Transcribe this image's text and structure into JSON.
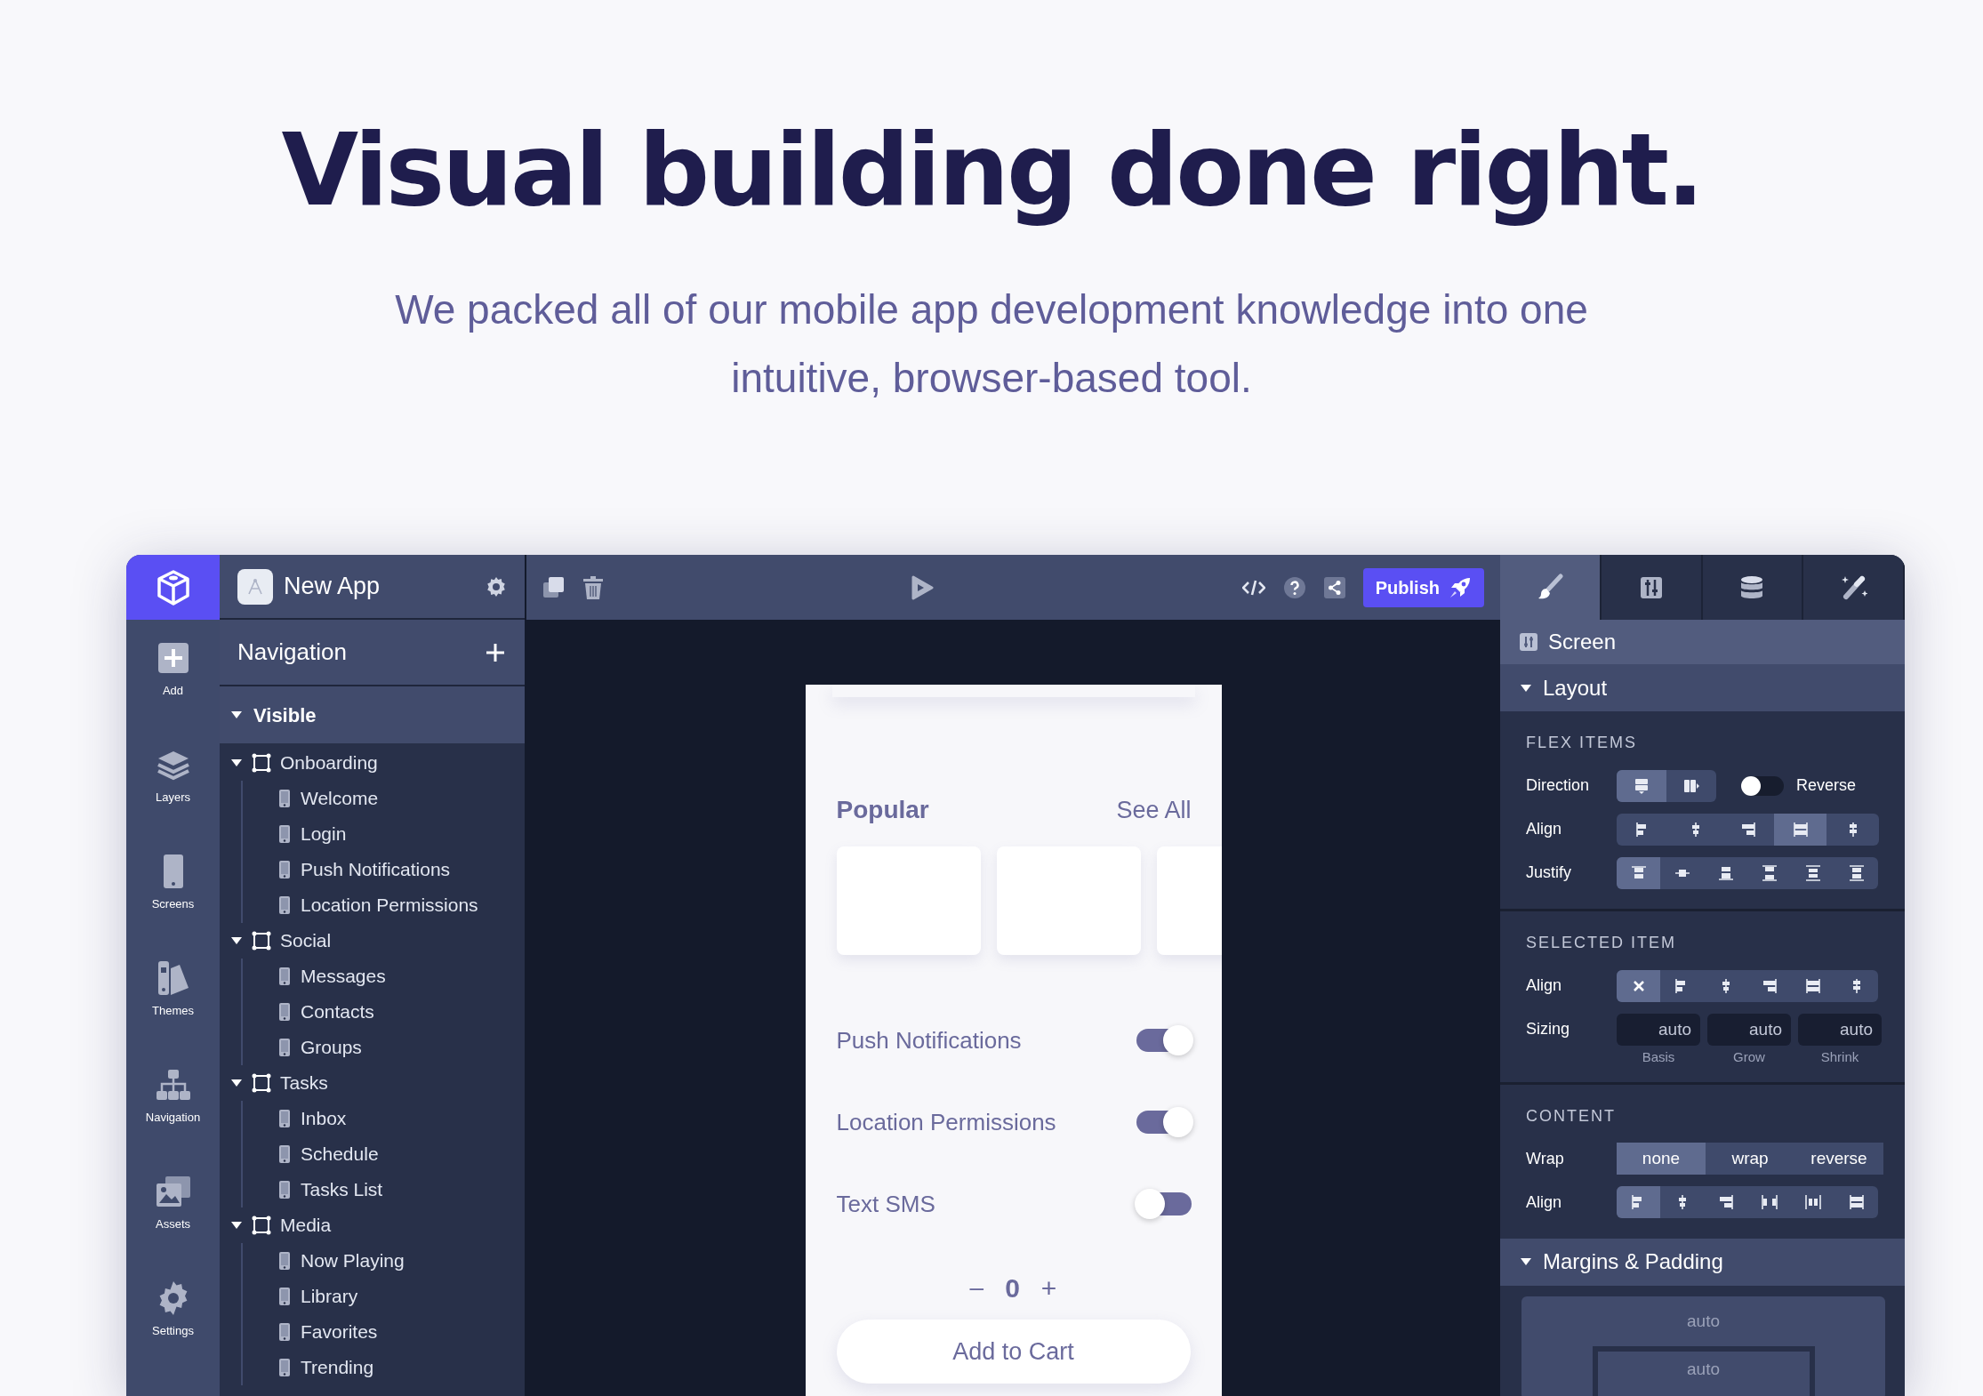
{
  "hero": {
    "title": "Visual building done right.",
    "subtitle": "We packed all of our mobile app development knowledge into one intuitive, browser-based tool."
  },
  "rail": [
    {
      "kind": "add",
      "label": "Add"
    },
    {
      "kind": "layers",
      "label": "Layers"
    },
    {
      "kind": "screens",
      "label": "Screens"
    },
    {
      "kind": "themes",
      "label": "Themes"
    },
    {
      "kind": "navigation",
      "label": "Navigation"
    },
    {
      "kind": "assets",
      "label": "Assets"
    },
    {
      "kind": "settings",
      "label": "Settings"
    }
  ],
  "project": {
    "name": "New App"
  },
  "tree_panel": {
    "title": "Navigation",
    "section": {
      "label": "Visible",
      "expanded": true
    },
    "groups": [
      {
        "label": "Onboarding",
        "expanded": true,
        "children": [
          {
            "label": "Welcome"
          },
          {
            "label": "Login"
          },
          {
            "label": "Push Notifications"
          },
          {
            "label": "Location Permissions"
          }
        ]
      },
      {
        "label": "Social",
        "expanded": true,
        "children": [
          {
            "label": "Messages"
          },
          {
            "label": "Contacts"
          },
          {
            "label": "Groups"
          }
        ]
      },
      {
        "label": "Tasks",
        "expanded": true,
        "children": [
          {
            "label": "Inbox"
          },
          {
            "label": "Schedule"
          },
          {
            "label": "Tasks List"
          }
        ]
      },
      {
        "label": "Media",
        "expanded": true,
        "children": [
          {
            "label": "Now Playing"
          },
          {
            "label": "Library"
          },
          {
            "label": "Favorites"
          },
          {
            "label": "Trending"
          }
        ]
      }
    ]
  },
  "toolbar": {
    "publish": "Publish"
  },
  "phone": {
    "section_title": "Popular",
    "see_all": "See All",
    "toggles": [
      {
        "label": "Push Notifications",
        "on": true
      },
      {
        "label": "Location Permissions",
        "on": true
      },
      {
        "label": "Text SMS",
        "on": false
      }
    ],
    "stepper": {
      "minus": "–",
      "value": "0",
      "plus": "+"
    },
    "cta": "Add to Cart"
  },
  "inspector": {
    "tabs": [
      {
        "kind": "style",
        "selected": true
      },
      {
        "kind": "layout",
        "selected": false
      },
      {
        "kind": "data",
        "selected": false
      },
      {
        "kind": "magic",
        "selected": false
      }
    ],
    "screen_title": "Screen",
    "layout": {
      "title": "Layout",
      "expanded": true
    },
    "flex_items": {
      "title": "FLEX ITEMS",
      "direction": {
        "label": "Direction",
        "options": [
          {
            "kind": "rows",
            "selected": true
          },
          {
            "kind": "columns",
            "selected": false
          }
        ]
      },
      "reverse": {
        "label": "Reverse",
        "on": false
      },
      "align": {
        "label": "Align",
        "options": [
          {
            "kind": "align-start",
            "selected": false
          },
          {
            "kind": "align-center",
            "selected": false
          },
          {
            "kind": "align-end",
            "selected": false
          },
          {
            "kind": "align-stretch",
            "selected": true
          },
          {
            "kind": "align-baseline",
            "selected": false
          }
        ]
      },
      "justify": {
        "label": "Justify",
        "options": [
          {
            "kind": "justify-start",
            "selected": true
          },
          {
            "kind": "justify-center",
            "selected": false
          },
          {
            "kind": "justify-end",
            "selected": false
          },
          {
            "kind": "justify-between",
            "selected": false
          },
          {
            "kind": "justify-around",
            "selected": false
          },
          {
            "kind": "justify-evenly",
            "selected": false
          }
        ]
      }
    },
    "selected_item": {
      "title": "SELECTED ITEM",
      "align": {
        "label": "Align",
        "options": [
          {
            "kind": "none",
            "selected": true
          },
          {
            "kind": "align-start",
            "selected": false
          },
          {
            "kind": "align-center",
            "selected": false
          },
          {
            "kind": "align-end",
            "selected": false
          },
          {
            "kind": "align-stretch",
            "selected": false
          },
          {
            "kind": "align-baseline",
            "selected": false
          }
        ]
      },
      "sizing": {
        "label": "Sizing",
        "fields": [
          {
            "value": "auto",
            "caption": "Basis"
          },
          {
            "value": "auto",
            "caption": "Grow"
          },
          {
            "value": "auto",
            "caption": "Shrink"
          }
        ]
      }
    },
    "content": {
      "title": "CONTENT",
      "wrap": {
        "label": "Wrap",
        "options": [
          {
            "label": "none",
            "selected": true
          },
          {
            "label": "wrap",
            "selected": false
          },
          {
            "label": "reverse",
            "selected": false
          }
        ]
      },
      "align": {
        "label": "Align",
        "options": [
          {
            "kind": "align-start",
            "selected": true
          },
          {
            "kind": "align-center",
            "selected": false
          },
          {
            "kind": "align-end",
            "selected": false
          },
          {
            "kind": "content-between",
            "selected": false
          },
          {
            "kind": "content-around",
            "selected": false
          },
          {
            "kind": "align-stretch",
            "selected": false
          }
        ]
      }
    },
    "margins": {
      "title": "Margins & Padding",
      "expanded": true,
      "margin": "auto",
      "padding": "auto"
    }
  }
}
